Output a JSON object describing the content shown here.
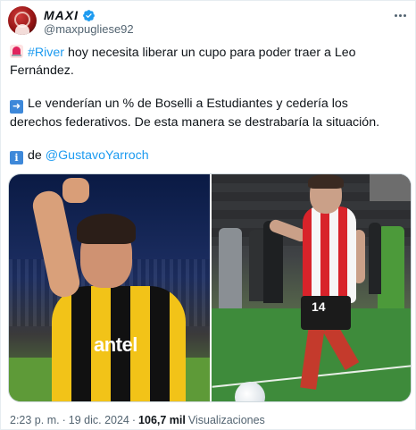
{
  "author": {
    "display_name": "MAXI",
    "handle": "@maxpugliese92",
    "verified": true,
    "avatar": "avatar-photo"
  },
  "tweet": {
    "para1": {
      "emoji": "siren-emoji",
      "hashtag": "#River",
      "text": " hoy necesita liberar un cupo para poder traer a Leo Fernández."
    },
    "para2": {
      "emoji": "right-arrow-emoji",
      "text": "Le venderían un % de Boselli a Estudiantes y cedería los derechos federativos. De esta manera se destrabaría la situación."
    },
    "para3": {
      "emoji": "information-emoji",
      "prefix": "de ",
      "mention": "@GustavoYarroch"
    }
  },
  "media": {
    "left_image": {
      "sponsor_text": "antel"
    },
    "right_image": {
      "shirt_number": "14"
    }
  },
  "footer": {
    "time": "2:23 p. m.",
    "separator1": "·",
    "date": "19 dic. 2024",
    "separator2": "·",
    "views_count": "106,7 mil",
    "views_label": "Visualizaciones"
  },
  "colors": {
    "link": "#1d9bf0",
    "secondary_text": "#536471",
    "primary_text": "#0f1419",
    "verified_badge": "#1d9bf0"
  }
}
